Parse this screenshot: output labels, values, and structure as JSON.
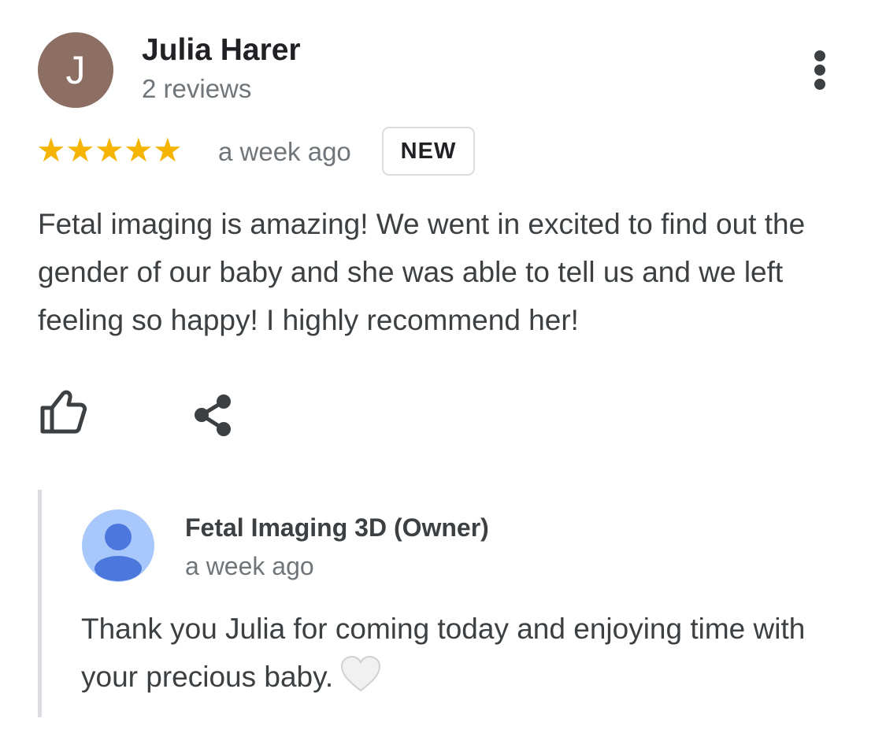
{
  "review": {
    "reviewer": {
      "avatar_initial": "J",
      "avatar_color": "#8d6e63",
      "name": "Julia Harer",
      "review_count": "2 reviews"
    },
    "menu_icon": "more-vert-icon",
    "rating": 5,
    "rating_max": 5,
    "star_glyph": "★",
    "star_color": "#f4b400",
    "time": "a week ago",
    "badge": "NEW",
    "text": "Fetal imaging is amazing! We went in excited to find out the gender of our baby and she was able to tell us and we left feeling so happy! I highly recommend her!",
    "actions": {
      "like_icon": "thumb-up-icon",
      "share_icon": "share-icon"
    }
  },
  "owner_reply": {
    "avatar_icon": "person-icon",
    "avatar_color": "#a8c7fa",
    "name": "Fetal Imaging 3D (Owner)",
    "time": "a week ago",
    "text": "Thank you Julia for coming today and enjoying time with your precious baby.",
    "emoji_icon": "white-heart-icon"
  },
  "colors": {
    "text_primary": "#202124",
    "text_body": "#3c4043",
    "text_secondary": "#70757a",
    "divider": "#dadce0"
  }
}
